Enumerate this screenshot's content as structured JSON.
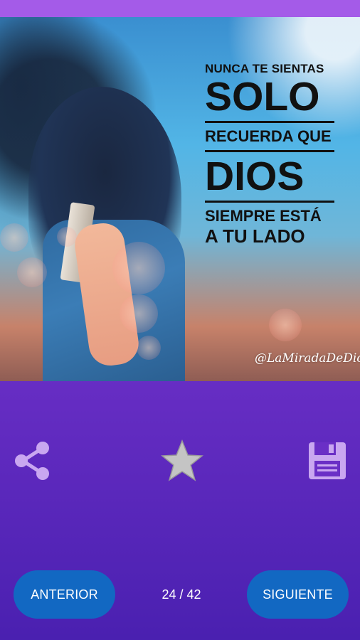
{
  "quote": {
    "line1": "NUNCA TE SIENTAS",
    "line2": "SOLO",
    "line3": "RECUERDA QUE",
    "line4": "DIOS",
    "line5": "SIEMPRE ESTÁ",
    "line6": "A TU LADO",
    "signature": "@LaMiradaDeDios"
  },
  "actions": {
    "share_icon": "share-icon",
    "favorite_icon": "star-icon",
    "save_icon": "floppy-disk-icon"
  },
  "navigation": {
    "prev_label": "ANTERIOR",
    "next_label": "SIGUIENTE",
    "page_counter": "24 / 42"
  },
  "colors": {
    "top_bar": "#a45be8",
    "background_top": "#8a3fd9",
    "background_bottom": "#4a20b0",
    "nav_button": "#1268c2",
    "icon_fill": "#c9a7f0",
    "star_fill": "#c4c4c4"
  }
}
